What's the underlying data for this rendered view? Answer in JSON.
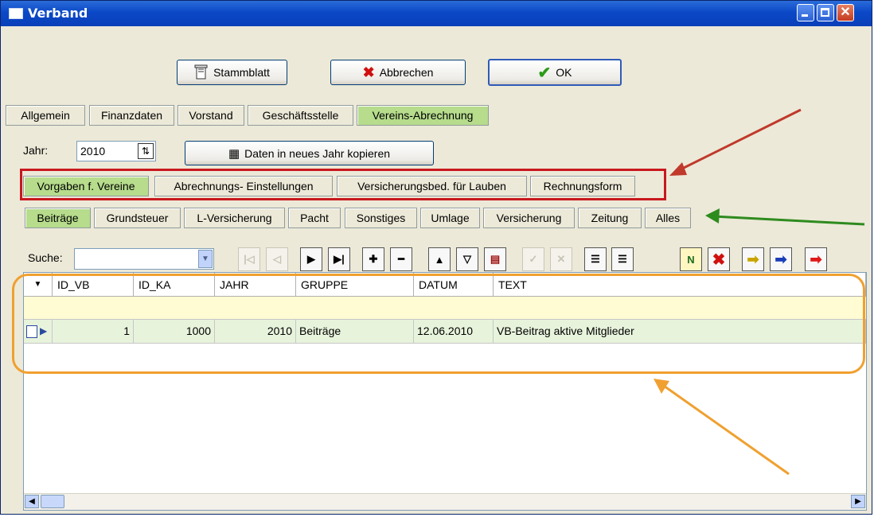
{
  "window": {
    "title": "Verband"
  },
  "toolbar": {
    "stammblatt_label": "Stammblatt",
    "abbrechen_label": "Abbrechen",
    "ok_label": "OK"
  },
  "main_tabs": [
    {
      "label": "Allgemein"
    },
    {
      "label": "Finanzdaten"
    },
    {
      "label": "Vorstand"
    },
    {
      "label": "Geschäftsstelle"
    },
    {
      "label": "Vereins-Abrechnung",
      "active": true
    }
  ],
  "year": {
    "label": "Jahr:",
    "value": "2010",
    "copy_button_label": "Daten in neues Jahr kopieren"
  },
  "sub_tabs": [
    {
      "label": "Vorgaben f. Vereine",
      "active": true
    },
    {
      "label": "Abrechnungs- Einstellungen"
    },
    {
      "label": "Versicherungsbed. für Lauben"
    },
    {
      "label": "Rechnungsform"
    }
  ],
  "category_tabs": [
    {
      "label": "Beiträge",
      "active": true
    },
    {
      "label": "Grundsteuer"
    },
    {
      "label": "L-Versicherung"
    },
    {
      "label": "Pacht"
    },
    {
      "label": "Sonstiges"
    },
    {
      "label": "Umlage"
    },
    {
      "label": "Versicherung"
    },
    {
      "label": "Zeitung"
    },
    {
      "label": "Alles"
    }
  ],
  "search": {
    "label": "Suche:",
    "value": ""
  },
  "grid": {
    "columns": [
      "ID_VB",
      "ID_KA",
      "JAHR",
      "GRUPPE",
      "DATUM",
      "TEXT"
    ],
    "rows": [
      [
        "1",
        "1000",
        "2010",
        "Beiträge",
        "12.06.2010",
        "VB-Beitrag aktive Mitglieder"
      ]
    ]
  },
  "colors": {
    "active_tab": "#b6dc8c",
    "annotation_red": "#c0392b",
    "annotation_green": "#2e8b1e",
    "annotation_orange": "#f0a030"
  }
}
